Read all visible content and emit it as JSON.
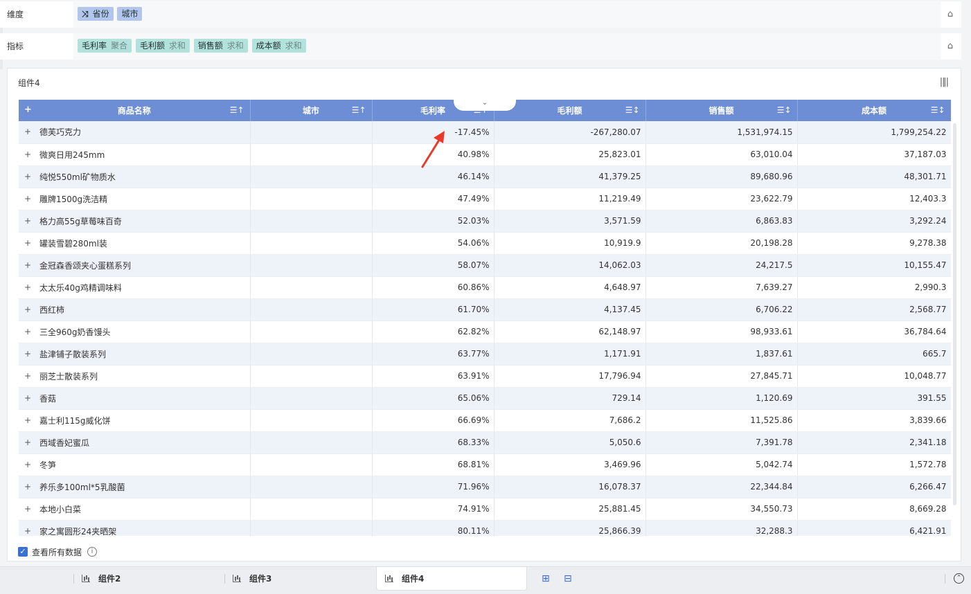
{
  "shelves": {
    "dimension": {
      "label": "维度",
      "pills": [
        {
          "label": "省份",
          "icon": "shuffle-icon"
        },
        {
          "label": "城市"
        }
      ]
    },
    "measure": {
      "label": "指标",
      "pills": [
        {
          "label": "毛利率",
          "agg": "聚合"
        },
        {
          "label": "毛利额",
          "agg": "求和"
        },
        {
          "label": "销售额",
          "agg": "求和"
        },
        {
          "label": "成本额",
          "agg": "求和"
        }
      ]
    }
  },
  "panel": {
    "title": "组件4"
  },
  "table": {
    "columns": [
      "商品名称",
      "城市",
      "毛利率",
      "毛利额",
      "销售额",
      "成本额"
    ],
    "rows": [
      [
        "德芙巧克力",
        "",
        "-17.45%",
        "-267,280.07",
        "1,531,974.15",
        "1,799,254.22"
      ],
      [
        "微爽日用245mm",
        "",
        "40.98%",
        "25,823.01",
        "63,010.04",
        "37,187.03"
      ],
      [
        "纯悦550ml矿物质水",
        "",
        "46.14%",
        "41,379.25",
        "89,680.96",
        "48,301.71"
      ],
      [
        "雕牌1500g洗洁精",
        "",
        "47.49%",
        "11,219.49",
        "23,622.79",
        "12,403.3"
      ],
      [
        "格力高55g草莓味百奇",
        "",
        "52.03%",
        "3,571.59",
        "6,863.83",
        "3,292.24"
      ],
      [
        "罐装雪碧280ml装",
        "",
        "54.06%",
        "10,919.9",
        "20,198.28",
        "9,278.38"
      ],
      [
        "金冠森香颂夹心蛋糕系列",
        "",
        "58.07%",
        "14,062.03",
        "24,217.5",
        "10,155.47"
      ],
      [
        "太太乐40g鸡精调味料",
        "",
        "60.86%",
        "4,648.97",
        "7,639.27",
        "2,990.3"
      ],
      [
        "西红柿",
        "",
        "61.70%",
        "4,137.45",
        "6,706.22",
        "2,568.77"
      ],
      [
        "三全960g奶香馒头",
        "",
        "62.82%",
        "62,148.97",
        "98,933.61",
        "36,784.64"
      ],
      [
        "盐津铺子散装系列",
        "",
        "63.77%",
        "1,171.91",
        "1,837.61",
        "665.7"
      ],
      [
        "丽芝士散装系列",
        "",
        "63.91%",
        "17,796.94",
        "27,845.71",
        "10,048.77"
      ],
      [
        "香菇",
        "",
        "65.06%",
        "729.14",
        "1,120.69",
        "391.55"
      ],
      [
        "嘉士利115g威化饼",
        "",
        "66.69%",
        "7,686.2",
        "11,525.86",
        "3,839.66"
      ],
      [
        "西域香妃蜜瓜",
        "",
        "68.33%",
        "5,050.6",
        "7,391.78",
        "2,341.18"
      ],
      [
        "冬笋",
        "",
        "68.81%",
        "3,469.96",
        "5,042.74",
        "1,572.78"
      ],
      [
        "养乐多100ml*5乳酸菌",
        "",
        "71.96%",
        "16,078.37",
        "22,344.84",
        "6,266.47"
      ],
      [
        "本地小白菜",
        "",
        "74.91%",
        "25,881.45",
        "34,550.73",
        "8,669.28"
      ],
      [
        "家之寓圆形24夹晒架",
        "",
        "80.11%",
        "25,866.39",
        "32,288.3",
        "6,421.91"
      ]
    ]
  },
  "footer": {
    "view_all_label": "查看所有数据",
    "view_all_checked": true
  },
  "bottom_tabs": [
    "组件2",
    "组件3",
    "组件4"
  ],
  "active_tab": "组件4",
  "colors": {
    "header_bg": "#6d8ed4",
    "dimension_pill": "#b2c5ec",
    "measure_pill": "#b3e2dc",
    "annotation_arrow": "#e8392b"
  }
}
